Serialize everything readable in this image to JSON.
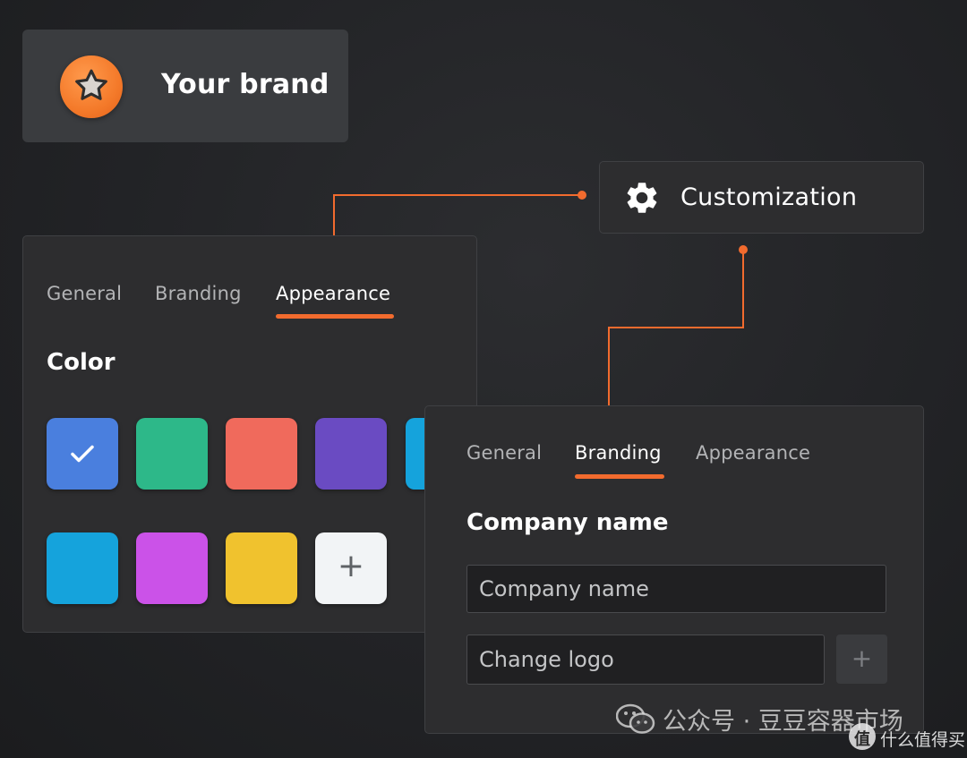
{
  "brand": {
    "name": "Your brand",
    "logo_icon": "star-icon",
    "logo_color": "#f47a2a"
  },
  "customization": {
    "label": "Customization",
    "icon": "gear-icon"
  },
  "appearance_panel": {
    "tabs": [
      {
        "label": "General",
        "active": false
      },
      {
        "label": "Branding",
        "active": false
      },
      {
        "label": "Appearance",
        "active": true
      }
    ],
    "section_title": "Color",
    "swatches": [
      {
        "color": "#4a7fde",
        "selected": true
      },
      {
        "color": "#2db889",
        "selected": false
      },
      {
        "color": "#f06a5c",
        "selected": false
      },
      {
        "color": "#6a4bc2",
        "selected": false
      },
      {
        "color": "#15a3dc",
        "selected": false
      },
      {
        "color": "#15a3dc",
        "selected": false
      },
      {
        "color": "#cb52e8",
        "selected": false
      },
      {
        "color": "#f0c22e",
        "selected": false
      }
    ],
    "add_swatch_label": "+"
  },
  "branding_panel": {
    "tabs": [
      {
        "label": "General",
        "active": false
      },
      {
        "label": "Branding",
        "active": true
      },
      {
        "label": "Appearance",
        "active": false
      }
    ],
    "section_title": "Company name",
    "company_input": {
      "value": "",
      "placeholder": "Company name"
    },
    "logo_input": {
      "value": "",
      "placeholder": "Change logo"
    },
    "logo_add_label": "+"
  },
  "accent_color": "#f26b2e",
  "watermark": {
    "text": "公众号 · 豆豆容器市场",
    "badge_text": "值",
    "corner_text": "什么值得买"
  }
}
